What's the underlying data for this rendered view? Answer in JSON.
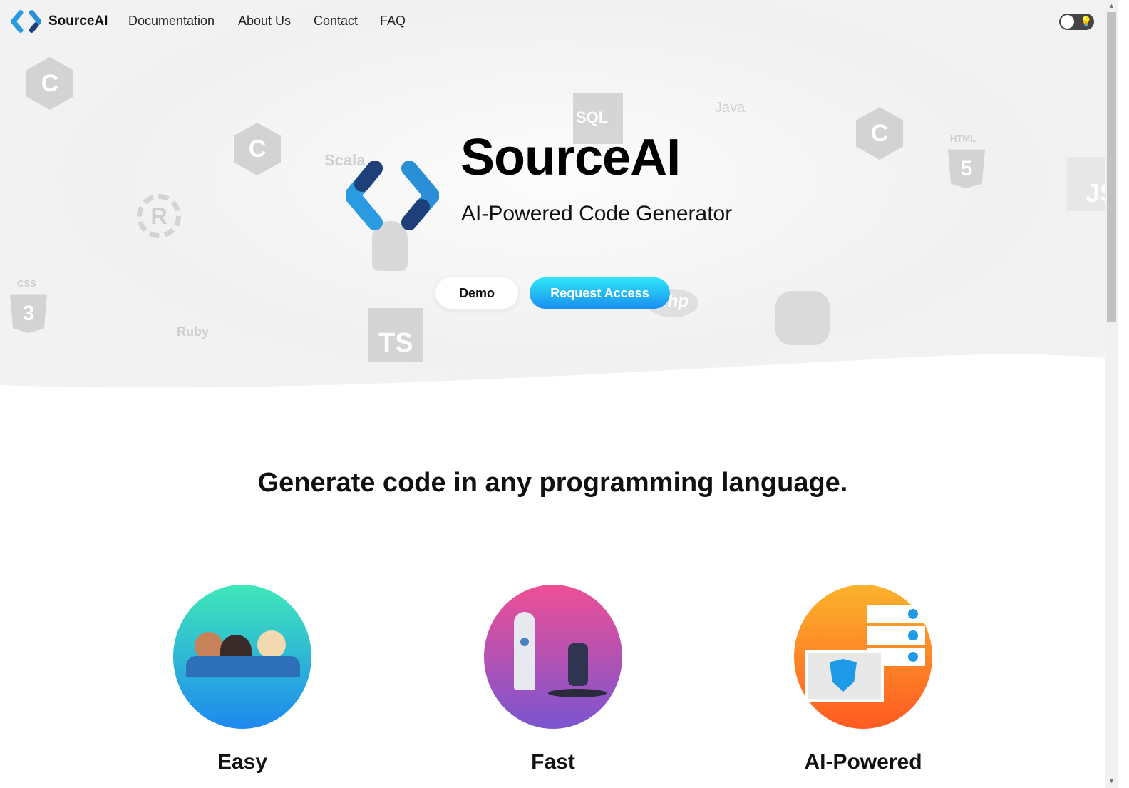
{
  "nav": {
    "brand": "SourceAI",
    "links": [
      "Documentation",
      "About Us",
      "Contact",
      "FAQ"
    ],
    "theme_toggle": {
      "state": "light",
      "icon": "lightbulb-icon"
    }
  },
  "hero": {
    "title": "SourceAI",
    "subtitle": "AI-Powered Code Generator",
    "demo_label": "Demo",
    "request_label": "Request Access",
    "background_logos": {
      "java": "Java",
      "scala": "Scala",
      "ruby": "Ruby",
      "sql": "SQL",
      "html": "HTML",
      "css": "CSS",
      "ts": "TS",
      "php": "php",
      "js": "JS"
    }
  },
  "section": {
    "heading": "Generate code in any programming language.",
    "features": [
      {
        "title": "Easy",
        "icon": "people-illustration"
      },
      {
        "title": "Fast",
        "icon": "rocket-illustration"
      },
      {
        "title": "AI-Powered",
        "icon": "server-shield-illustration"
      }
    ]
  },
  "colors": {
    "accent_start": "#2ee6f8",
    "accent_end": "#1a8ff0",
    "logo_blue": "#2a8fd6",
    "logo_dark": "#1f3f7a"
  }
}
